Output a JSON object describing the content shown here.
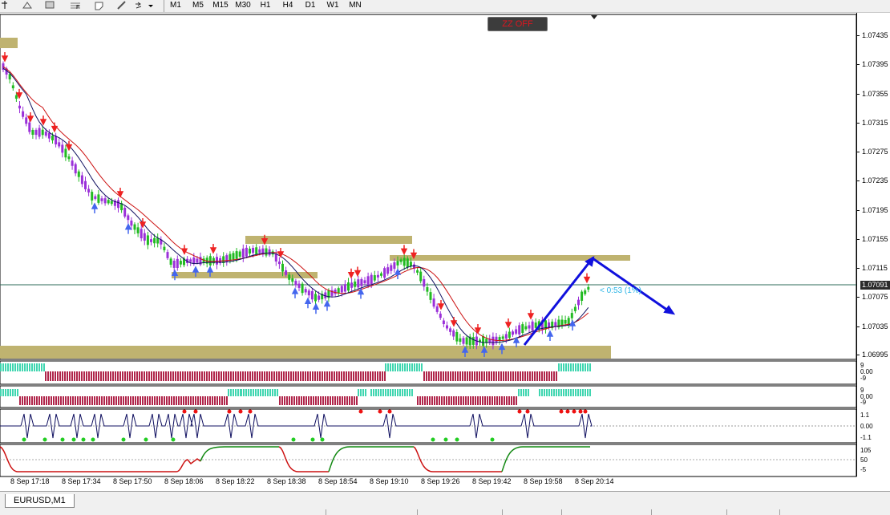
{
  "toolbar": {
    "timeframes": [
      "M1",
      "M5",
      "M15",
      "M30",
      "H1",
      "H4",
      "D1",
      "W1",
      "MN"
    ],
    "fib_letter": "F"
  },
  "zz_button": {
    "label": "ZZ OFF"
  },
  "price_axis": {
    "ticks": [
      "1.07435",
      "1.07395",
      "1.07355",
      "1.07315",
      "1.07275",
      "1.07235",
      "1.07195",
      "1.07155",
      "1.07115",
      "1.07075",
      "1.07035",
      "1.06995"
    ],
    "current": "1.07091"
  },
  "countdown": {
    "text": "< 0:53 (1%)"
  },
  "indicators": {
    "hist1_ticks": [
      "9",
      "0.00",
      "-9"
    ],
    "hist2_ticks": [
      "9",
      "0.00",
      "-9"
    ],
    "osc_ticks": [
      "1.1",
      "0.00",
      "-1.1"
    ],
    "line_ticks": [
      "105",
      "50",
      "-5"
    ]
  },
  "time_axis": [
    "8 Sep 17:18",
    "8 Sep 17:34",
    "8 Sep 17:50",
    "8 Sep 18:06",
    "8 Sep 18:22",
    "8 Sep 18:38",
    "8 Sep 18:54",
    "8 Sep 19:10",
    "8 Sep 19:26",
    "8 Sep 19:42",
    "8 Sep 19:58",
    "8 Sep 20:14"
  ],
  "tab": {
    "label": "EURUSD,M1"
  },
  "colors": {
    "zone": "#bfb370",
    "bull": "#22bb22",
    "bear": "#9b30d9",
    "up_arrow": "#4466ee",
    "down_arrow": "#ee2222",
    "ma_red": "#cc1111",
    "ma_navy": "#101060",
    "pattern": "#1010dd",
    "hist_up": "#3fd6b0",
    "hist_down": "#b0254a"
  }
}
